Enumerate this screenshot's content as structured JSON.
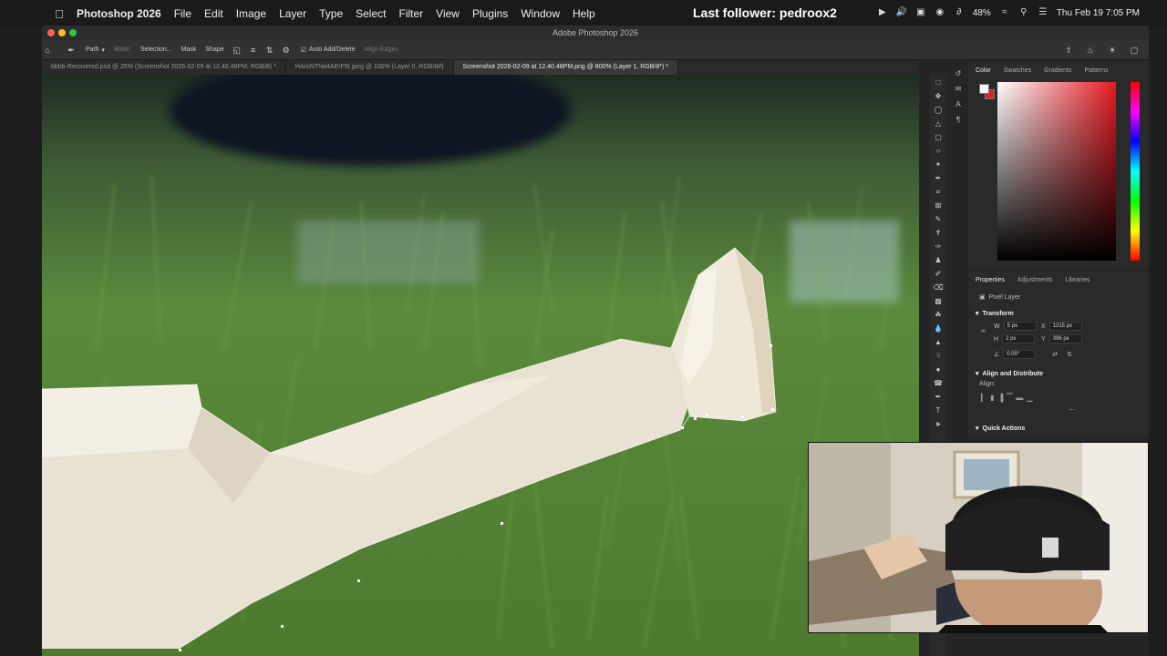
{
  "menubar": {
    "app_name": "Photoshop 2026",
    "items": [
      "File",
      "Edit",
      "Image",
      "Layer",
      "Type",
      "Select",
      "Filter",
      "View",
      "Plugins",
      "Window",
      "Help"
    ],
    "overlay_text": "Last follower: pedroox2",
    "battery": "48%",
    "clock": "Thu Feb 19  7:05 PM"
  },
  "window": {
    "title": "Adobe Photoshop 2026"
  },
  "options": {
    "tool_mode": "Path",
    "make_label": "Make:",
    "selection_button": "Selection...",
    "mask_button": "Mask",
    "shape_button": "Shape",
    "auto_add_delete": "Auto Add/Delete",
    "align_edges": "Align Edges"
  },
  "tabs": [
    {
      "label": "bbbb-Recovered.psd @ 25% (Screenshot 2026-02-09 at 12.40.48PM, RGB/8) *",
      "active": false
    },
    {
      "label": "HAroNTNa4AErF5t.jpeg @ 100% (Layer 0, RGB/8#)",
      "active": false
    },
    {
      "label": "Screenshot 2026-02-09 at 12.40.48PM.png @ 800% (Layer 1, RGB/8*) *",
      "active": true
    }
  ],
  "color_panel": {
    "tabs": [
      "Color",
      "Swatches",
      "Gradients",
      "Patterns"
    ],
    "foreground": "#ffffff",
    "background": "#e0212a"
  },
  "properties": {
    "tabs": [
      "Properties",
      "Adjustments",
      "Libraries"
    ],
    "layer_type": "Pixel Layer",
    "transform_label": "Transform",
    "w_label": "W",
    "w_value": "5 px",
    "h_label": "H",
    "h_value": "2 px",
    "x_label": "X",
    "x_value": "1215 px",
    "y_label": "Y",
    "y_value": "396 px",
    "angle_value": "0.00°",
    "align_distribute_label": "Align and Distribute",
    "align_label": "Align:",
    "quick_actions_label": "Quick Actions"
  }
}
